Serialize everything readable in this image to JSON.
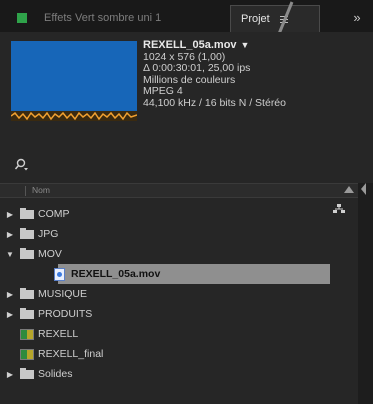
{
  "tabs": {
    "effects_label": "Effets Vert sombre uni 1",
    "project_label": "Projet",
    "more_glyph": "»"
  },
  "preview": {
    "name": "REXELL_05a.mov",
    "name_caret": "▼",
    "lines": [
      "1024 x 576 (1,00)",
      "Δ 0:00:30:01, 25,00 ips",
      "Millions de couleurs",
      "MPEG 4",
      "44,100 kHz / 16 bits N / Stéréo"
    ]
  },
  "search": {
    "icon": "search-icon",
    "placeholder": ""
  },
  "list_header": {
    "name_column": "Nom"
  },
  "items": [
    {
      "label": "COMP",
      "type": "folder",
      "expanded": false
    },
    {
      "label": "JPG",
      "type": "folder",
      "expanded": false
    },
    {
      "label": "MOV",
      "type": "folder",
      "expanded": true
    },
    {
      "label": "REXELL_05a.mov",
      "type": "footage",
      "selected": true
    },
    {
      "label": "MUSIQUE",
      "type": "folder",
      "expanded": false
    },
    {
      "label": "PRODUITS",
      "type": "folder",
      "expanded": false
    },
    {
      "label": "REXELL",
      "type": "composition"
    },
    {
      "label": "REXELL_final",
      "type": "composition"
    },
    {
      "label": "Solides",
      "type": "folder",
      "expanded": false
    }
  ],
  "colors": {
    "preview_blue": "#1766b8",
    "label_green": "#2fa34a",
    "selection": "#8f8f8f"
  }
}
